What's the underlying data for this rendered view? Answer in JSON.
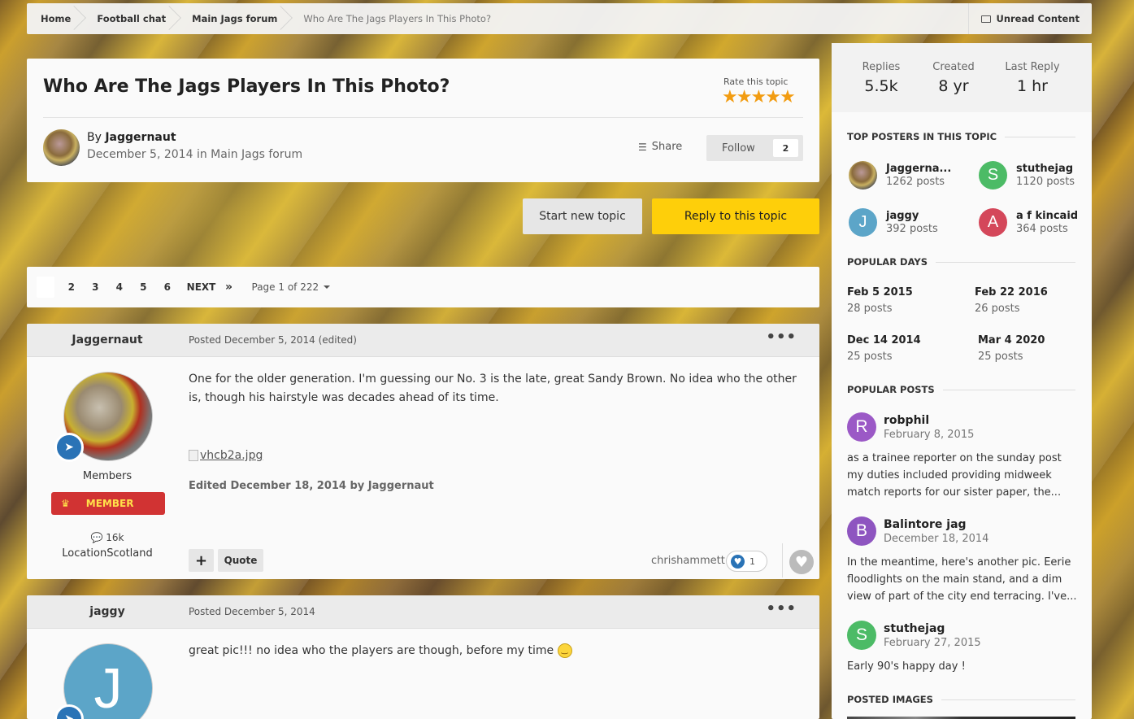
{
  "breadcrumb": {
    "items": [
      "Home",
      "Football chat",
      "Main Jags forum",
      "Who Are The Jags Players In This Photo?"
    ],
    "unread": "Unread Content"
  },
  "topic": {
    "title": "Who Are The Jags Players In This Photo?",
    "rate_label": "Rate this topic",
    "rating": 5,
    "by_prefix": "By",
    "author": "Jaggernaut",
    "date": "December 5, 2014",
    "in_word": "in",
    "forum": "Main Jags forum",
    "share_label": "Share",
    "follow_label": "Follow",
    "follow_count": "2"
  },
  "actions": {
    "start_new": "Start new topic",
    "reply": "Reply to this topic"
  },
  "pagination": {
    "pages": [
      "2",
      "3",
      "4",
      "5",
      "6"
    ],
    "next": "NEXT",
    "last": "»",
    "page_of": "Page 1 of 222"
  },
  "posts": [
    {
      "author": "Jaggernaut",
      "posted": "Posted December 5, 2014 (edited)",
      "group": "Members",
      "badge": "MEMBER",
      "post_count": "16k",
      "location": "LocationScotland",
      "body": "One for the older generation. I'm guessing our No. 3 is the late, great Sandy Brown. No idea who the other is, though his hairstyle was decades ahead of its time.",
      "image_alt": "vhcb2a.jpg",
      "edited": "Edited December 18, 2014 by Jaggernaut",
      "quote": "Quote",
      "plus": "+",
      "liked_by": "chrishammett",
      "reaction_count": "1"
    },
    {
      "author": "jaggy",
      "posted": "Posted December 5, 2014",
      "avatar_letter": "J",
      "body": "great pic!!! no idea who the players are though, before my time"
    }
  ],
  "sidebar": {
    "stats": [
      {
        "label": "Replies",
        "value": "5.5k"
      },
      {
        "label": "Created",
        "value": "8 yr"
      },
      {
        "label": "Last Reply",
        "value": "1 hr"
      }
    ],
    "top_posters_title": "TOP POSTERS IN THIS TOPIC",
    "top_posters": [
      {
        "name": "Jaggerna...",
        "posts": "1262 posts",
        "letter": "",
        "color": "#8a6b3c"
      },
      {
        "name": "stuthejag",
        "posts": "1120 posts",
        "letter": "S",
        "color": "#4cbb66"
      },
      {
        "name": "jaggy",
        "posts": "392 posts",
        "letter": "J",
        "color": "#5ca5c8"
      },
      {
        "name": "a f kincaid",
        "posts": "364 posts",
        "letter": "A",
        "color": "#d4475a"
      }
    ],
    "popular_days_title": "POPULAR DAYS",
    "popular_days": [
      {
        "date": "Feb 5 2015",
        "posts": "28 posts"
      },
      {
        "date": "Feb 22 2016",
        "posts": "26 posts"
      },
      {
        "date": "Dec 14 2014",
        "posts": "25 posts"
      },
      {
        "date": "Mar 4 2020",
        "posts": "25 posts"
      }
    ],
    "popular_posts_title": "POPULAR POSTS",
    "popular_posts": [
      {
        "letter": "R",
        "color": "#9b59c6",
        "name": "robphil",
        "date": "February 8, 2015",
        "text": "as a trainee reporter on the sunday post my duties included providing midweek match reports for our sister paper, the..."
      },
      {
        "letter": "B",
        "color": "#8e55c0",
        "name": "Balintore jag",
        "date": "December 18, 2014",
        "text": "In the meantime, here's another pic. Eerie floodlights on the main stand, and a dim view of part of the city end terracing. I've..."
      },
      {
        "letter": "S",
        "color": "#4cbb66",
        "name": "stuthejag",
        "date": "February 27, 2015",
        "text": "Early 90's happy day !"
      }
    ],
    "posted_images_title": "POSTED IMAGES"
  }
}
